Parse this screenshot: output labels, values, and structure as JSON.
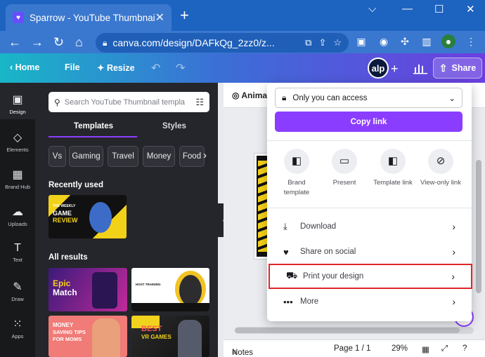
{
  "browser": {
    "tab_title": "Sparrow - YouTube Thumbnail",
    "tab_close": "✕",
    "new_tab": "+",
    "window_controls": [
      "⌵",
      "—",
      "☐",
      "✕"
    ],
    "url": "canva.com/design/DAFkQg_2zz0/z..."
  },
  "canva": {
    "home_label": "Home",
    "file_label": "File",
    "resize_label": "Resize",
    "avatar_initials": "alp",
    "share_label": "Share"
  },
  "rail": [
    {
      "label": "Design",
      "icon": "layout-icon"
    },
    {
      "label": "Elements",
      "icon": "shapes-icon"
    },
    {
      "label": "Brand Hub",
      "icon": "brand-icon"
    },
    {
      "label": "Uploads",
      "icon": "cloud-upload-icon"
    },
    {
      "label": "Text",
      "icon": "text-icon"
    },
    {
      "label": "Draw",
      "icon": "pen-icon"
    },
    {
      "label": "Apps",
      "icon": "apps-icon"
    }
  ],
  "panel": {
    "search_placeholder": "Search YouTube Thumbnail templa",
    "tabs": [
      "Templates",
      "Styles"
    ],
    "chips": [
      "Vs",
      "Gaming",
      "Travel",
      "Money",
      "Food"
    ],
    "recently_used": "Recently used",
    "all_results": "All results",
    "thumbs": {
      "recent": [
        "THE WEEKLY",
        "GAME",
        "REVIEW"
      ],
      "epic": [
        "Epic",
        "Match"
      ],
      "host": "HOST TRAINING",
      "money": [
        "MONEY",
        "SAVING TIPS",
        "FOR MOMS"
      ],
      "best": [
        "BEST",
        "VR GAMES"
      ]
    }
  },
  "editor": {
    "animate_label": "Animate",
    "notes_label": "Notes",
    "page_label": "Page 1 / 1",
    "zoom_label": "29%"
  },
  "share_menu": {
    "access_label": "Only you can access",
    "copy_link_label": "Copy link",
    "options": [
      {
        "label": "Brand template",
        "icon": "brand-template-icon"
      },
      {
        "label": "Present",
        "icon": "present-icon"
      },
      {
        "label": "Template link",
        "icon": "template-link-icon"
      },
      {
        "label": "View-only link",
        "icon": "link-icon"
      }
    ],
    "rows": [
      {
        "label": "Download",
        "icon": "download-icon"
      },
      {
        "label": "Share on social",
        "icon": "heart-icon"
      },
      {
        "label": "Print your design",
        "icon": "truck-icon"
      },
      {
        "label": "More",
        "icon": "more-icon"
      }
    ]
  },
  "colors": {
    "accent": "#8b3dff",
    "highlight_box": "#e0252b",
    "browser_blue": "#1d63c0"
  }
}
